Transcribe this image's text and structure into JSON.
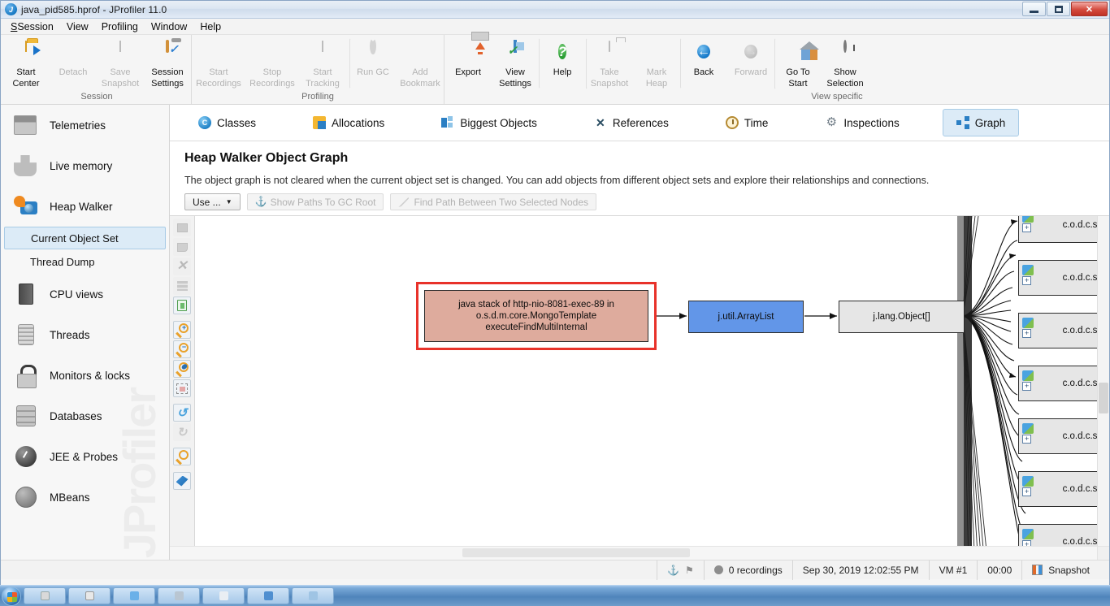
{
  "window": {
    "title": "java_pid585.hprof - JProfiler 11.0",
    "icon": "jprofiler-icon",
    "controls": {
      "minimize": "–",
      "maximize": "❐",
      "close": "✕"
    }
  },
  "menubar": {
    "items": [
      {
        "label": "Session",
        "mnemonic": "S"
      },
      {
        "label": "View",
        "mnemonic": "V"
      },
      {
        "label": "Profiling",
        "mnemonic": "P"
      },
      {
        "label": "Window",
        "mnemonic": "W"
      },
      {
        "label": "Help",
        "mnemonic": "H"
      }
    ]
  },
  "toolbar": {
    "groups": [
      {
        "label": "Session",
        "buttons": [
          {
            "label": "Start\nCenter",
            "line1": "Start",
            "line2": "Center",
            "icon": "start-center-icon",
            "enabled": true
          },
          {
            "line1": "Detach",
            "line2": "",
            "icon": "detach-icon",
            "enabled": false
          },
          {
            "line1": "Save",
            "line2": "Snapshot",
            "icon": "save-snapshot-icon",
            "enabled": false
          },
          {
            "line1": "Session",
            "line2": "Settings",
            "icon": "session-settings-icon",
            "enabled": true
          }
        ]
      },
      {
        "label": "Profiling",
        "buttons": [
          {
            "line1": "Start",
            "line2": "Recordings",
            "icon": "start-recordings-icon",
            "enabled": false
          },
          {
            "line1": "Stop",
            "line2": "Recordings",
            "icon": "stop-recordings-icon",
            "enabled": false
          },
          {
            "line1": "Start",
            "line2": "Tracking",
            "icon": "start-tracking-icon",
            "enabled": false
          },
          {
            "line1": "Run GC",
            "line2": "",
            "icon": "run-gc-icon",
            "enabled": false
          },
          {
            "line1": "Add",
            "line2": "Bookmark",
            "icon": "add-bookmark-icon",
            "enabled": false
          }
        ]
      },
      {
        "label": "View specific",
        "buttons": [
          {
            "line1": "Export",
            "line2": "",
            "icon": "export-icon",
            "enabled": true
          },
          {
            "line1": "View",
            "line2": "Settings",
            "icon": "view-settings-icon",
            "enabled": true
          },
          {
            "line1": "Help",
            "line2": "",
            "icon": "help-icon",
            "enabled": true
          },
          {
            "line1": "Take",
            "line2": "Snapshot",
            "icon": "take-snapshot-icon",
            "enabled": false
          },
          {
            "line1": "Mark",
            "line2": "Heap",
            "icon": "mark-heap-icon",
            "enabled": false
          },
          {
            "line1": "Back",
            "line2": "",
            "icon": "back-arrow-icon",
            "enabled": true
          },
          {
            "line1": "Forward",
            "line2": "",
            "icon": "forward-arrow-icon",
            "enabled": false
          },
          {
            "line1": "Go To",
            "line2": "Start",
            "icon": "go-to-start-icon",
            "enabled": true
          },
          {
            "line1": "Show",
            "line2": "Selection",
            "icon": "show-selection-icon",
            "enabled": true
          }
        ]
      }
    ]
  },
  "sidebar": {
    "items": [
      {
        "label": "Telemetries",
        "icon": "telemetries-icon"
      },
      {
        "label": "Live memory",
        "icon": "live-memory-icon"
      },
      {
        "label": "Heap Walker",
        "icon": "heap-walker-icon"
      }
    ],
    "sub_items": [
      {
        "label": "Current Object Set",
        "selected": true
      },
      {
        "label": "Thread Dump",
        "selected": false
      }
    ],
    "items_after": [
      {
        "label": "CPU views",
        "icon": "cpu-views-icon"
      },
      {
        "label": "Threads",
        "icon": "threads-icon"
      },
      {
        "label": "Monitors & locks",
        "icon": "monitors-locks-icon"
      },
      {
        "label": "Databases",
        "icon": "databases-icon"
      },
      {
        "label": "JEE & Probes",
        "icon": "jee-probes-icon"
      },
      {
        "label": "MBeans",
        "icon": "mbeans-icon"
      }
    ],
    "watermark": "JProfiler"
  },
  "tabs": [
    {
      "label": "Classes",
      "icon": "classes-icon",
      "active": false
    },
    {
      "label": "Allocations",
      "icon": "allocations-icon",
      "active": false
    },
    {
      "label": "Biggest Objects",
      "icon": "biggest-objects-icon",
      "active": false
    },
    {
      "label": "References",
      "icon": "references-icon",
      "active": false
    },
    {
      "label": "Time",
      "icon": "time-icon",
      "active": false
    },
    {
      "label": "Inspections",
      "icon": "inspections-icon",
      "active": false
    },
    {
      "label": "Graph",
      "icon": "graph-icon",
      "active": true
    }
  ],
  "page": {
    "title": "Heap Walker Object Graph",
    "description": "The object graph is not cleared when the current object set is changed. You can add objects from different object sets and explore their relationships and connections."
  },
  "graph_toolbar": {
    "use_button": "Use ...",
    "use_caret": "▼",
    "show_paths_button": "Show Paths To GC Root",
    "find_path_button": "Find Path Between Two Selected Nodes"
  },
  "graph_vtoolbar": {
    "buttons": [
      {
        "name": "show-incoming-references-button",
        "icon": "node-left-icon",
        "enabled": false
      },
      {
        "name": "show-outgoing-references-button",
        "icon": "node-right-icon",
        "enabled": false
      },
      {
        "name": "remove-selected-nodes-button",
        "icon": "close-x-icon",
        "enabled": false
      },
      {
        "name": "collapse-node-button",
        "icon": "bars-icon",
        "enabled": false
      },
      {
        "name": "clear-graph-button",
        "icon": "trash-icon",
        "enabled": true
      },
      {
        "name": "zoom-in-button",
        "icon": "magnifier-plus-icon",
        "enabled": true
      },
      {
        "name": "zoom-out-button",
        "icon": "magnifier-minus-icon",
        "enabled": true
      },
      {
        "name": "zoom-100-button",
        "icon": "magnifier-100-icon",
        "enabled": true
      },
      {
        "name": "fit-content-button",
        "icon": "fit-content-icon",
        "enabled": true
      },
      {
        "name": "undo-button",
        "icon": "undo-arrow-icon",
        "enabled": true
      },
      {
        "name": "redo-button",
        "icon": "redo-arrow-icon",
        "enabled": false
      },
      {
        "name": "find-button",
        "icon": "magnifier-icon",
        "enabled": true
      },
      {
        "name": "export-graph-button",
        "icon": "export-blue-icon",
        "enabled": true
      }
    ]
  },
  "graph": {
    "nodes": [
      {
        "id": "thread-stack-node",
        "label": "java stack of http-nio-8081-exec-89 in o.s.d.m.core.MongoTemplate executeFindMultiInternal",
        "lines": [
          "java stack of http-nio-8081-exec-89 in",
          "o.s.d.m.core.MongoTemplate",
          "executeFindMultiInternal"
        ],
        "style": "selected",
        "fill": "#deab9d",
        "border": "#e8322a"
      },
      {
        "id": "arraylist-node",
        "label": "j.util.ArrayList",
        "style": "blue",
        "fill": "#6296e8",
        "border": "#2c2c2c"
      },
      {
        "id": "objectarray-node",
        "label": "j.lang.Object[]",
        "style": "plain",
        "fill": "#e6e6e6",
        "border": "#2c2c2c"
      }
    ],
    "right_nodes": [
      {
        "label": "c.o.d.c.s.e",
        "expander": "+"
      },
      {
        "label": "c.o.d.c.s.e",
        "expander": "+"
      },
      {
        "label": "c.o.d.c.s.e",
        "expander": "+"
      },
      {
        "label": "c.o.d.c.s.e",
        "expander": "+"
      },
      {
        "label": "c.o.d.c.s.e",
        "expander": "+"
      },
      {
        "label": "c.o.d.c.s.e",
        "expander": "+"
      },
      {
        "label": "c.o.d.c.s.e",
        "expander": "+"
      }
    ]
  },
  "statusbar": {
    "anchor_icon": "anchor-icon",
    "flag_icon": "flag-icon",
    "recordings": "0 recordings",
    "timestamp": "Sep 30, 2019 12:02:55 PM",
    "vm": "VM #1",
    "elapsed": "00:00",
    "mode": "Snapshot"
  },
  "taskbar": {
    "start_label": "",
    "tasks": [
      "",
      "",
      "",
      "",
      "",
      ""
    ]
  },
  "colors": {
    "accent": "#2b7fc4",
    "selection_bg": "#dcebf7",
    "selection_border": "#a8cbe6",
    "node_selected_border": "#e8322a",
    "node_selected_fill": "#deab9d",
    "node_blue_fill": "#6296e8",
    "node_plain_fill": "#e6e6e6"
  }
}
